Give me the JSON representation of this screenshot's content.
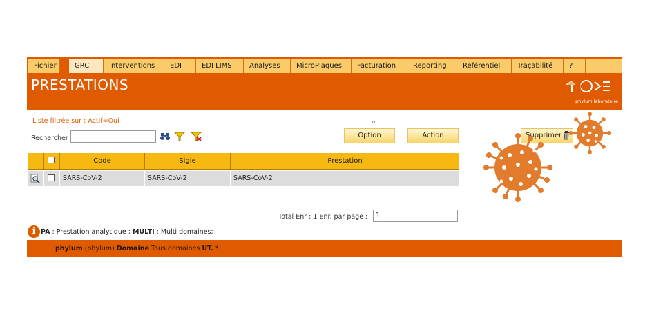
{
  "menu": [
    {
      "label": "Fichier"
    },
    {
      "label": "GRC"
    },
    {
      "label": "Interventions"
    },
    {
      "label": "EDI"
    },
    {
      "label": "EDI LIMS"
    },
    {
      "label": "Analyses"
    },
    {
      "label": "MicroPlaques"
    },
    {
      "label": "Facturation"
    },
    {
      "label": "Reporting"
    },
    {
      "label": "Référentiel"
    },
    {
      "label": "Traçabilité"
    },
    {
      "label": "?"
    }
  ],
  "header": {
    "title": "PRESTATIONS",
    "logo_text": "phylum.laboratoire"
  },
  "filter": {
    "text": "Liste filtrée sur : Actif=Oui"
  },
  "search": {
    "label": "Rechercher",
    "value": ""
  },
  "buttons": {
    "option": "Option",
    "action": "Action",
    "delete": "Supprimer"
  },
  "table": {
    "columns": [
      "Code",
      "Sigle",
      "Prestation"
    ],
    "rows": [
      {
        "code": "SARS-CoV-2",
        "sigle": "SARS-CoV-2",
        "prestation": "SARS-CoV-2"
      }
    ]
  },
  "pagination": {
    "total_label": "Total Enr : 1  Enr. par page :",
    "per_page": "1"
  },
  "legend": {
    "pa_key": "PA",
    "pa_text": " : Prestation analytique ; ",
    "multi_key": "MULTI",
    "multi_text": " : Multi domaines;"
  },
  "footer": {
    "user": "phylum",
    "user_paren": " (phylum) ",
    "domain_label": "Domaine",
    "domain_value": " Tous domaines ",
    "ut_label": "UT.",
    "ut_value": " *"
  },
  "colors": {
    "brand_orange": "#e05a00",
    "menu_yellow": "#fbcb6a",
    "table_header": "#f7b811",
    "virus_orange": "#e27b2c"
  },
  "icons": [
    "binoculars-icon",
    "filter-icon",
    "clear-filter-icon",
    "trash-icon",
    "view-icon",
    "info-icon",
    "logo-icon"
  ]
}
